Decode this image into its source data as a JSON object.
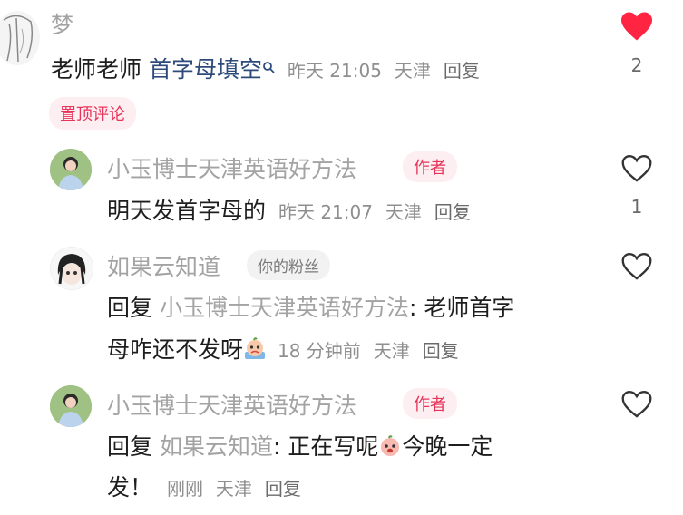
{
  "main_comment": {
    "username": "梦",
    "text_prefix": "老师老师 ",
    "search_link": "首字母填空",
    "time": "昨天 21:05",
    "location": "天津",
    "reply_label": "回复",
    "like_count": "2",
    "pinned_badge": "置顶评论"
  },
  "replies": [
    {
      "username": "小玉博士天津英语好方法",
      "badge": "作者",
      "text": "明天发首字母的",
      "time": "昨天 21:07",
      "location": "天津",
      "reply_label": "回复",
      "like_count": "1"
    },
    {
      "username": "如果云知道",
      "badge": "你的粉丝",
      "reply_prefix": "回复",
      "reply_to": "小玉博士天津英语好方法",
      "colon": ":",
      "text_line1": " 老师首字",
      "text_line2": "母咋还不发呀",
      "time": "18 分钟前",
      "location": "天津",
      "reply_label": "回复"
    },
    {
      "username": "小玉博士天津英语好方法",
      "badge": "作者",
      "reply_prefix": "回复",
      "reply_to": "如果云知道",
      "colon": ":",
      "text_line1a": " 正在写呢",
      "text_line1b": "今晚一定",
      "text_line2": "发！",
      "time": "刚刚",
      "location": "天津",
      "reply_label": "回复"
    }
  ],
  "colors": {
    "accent_red": "#ff2442",
    "author_badge": "#e8345a",
    "link_blue": "#2e4a7a"
  },
  "icons": {
    "search": "search-icon",
    "heart_filled": "heart-filled-icon",
    "heart_outline": "heart-outline-icon"
  }
}
